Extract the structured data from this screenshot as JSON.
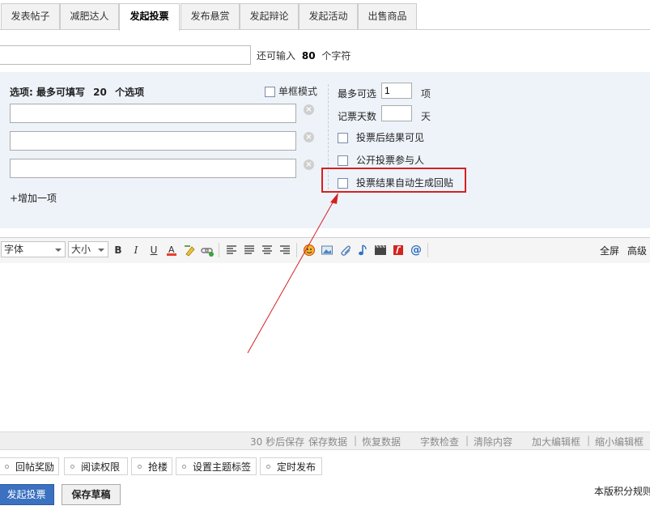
{
  "tabs": [
    {
      "label": "发表帖子",
      "active": false
    },
    {
      "label": "减肥达人",
      "active": false
    },
    {
      "label": "发起投票",
      "active": true
    },
    {
      "label": "发布悬赏",
      "active": false
    },
    {
      "label": "发起辩论",
      "active": false
    },
    {
      "label": "发起活动",
      "active": false
    },
    {
      "label": "出售商品",
      "active": false
    }
  ],
  "subject": {
    "value": "",
    "hint_prefix": "还可输入",
    "remaining": "80",
    "hint_suffix": "个字符"
  },
  "poll": {
    "options_header_prefix": "选项: 最多可填写",
    "max_options": "20",
    "options_header_suffix": "个选项",
    "single_mode_label": "单框模式",
    "options": [
      "",
      "",
      ""
    ],
    "add_option_label": "+增加一项",
    "max_choices_label": "最多可选",
    "max_choices_value": "1",
    "max_choices_unit": "项",
    "days_label": "记票天数",
    "days_value": "",
    "days_unit": "天",
    "check_visible_after_vote": "投票后结果可见",
    "check_public_voters": "公开投票参与人",
    "check_auto_reply": "投票结果自动生成回贴"
  },
  "toolbar": {
    "font_select": "字体",
    "size_select": "大小",
    "bold": "B",
    "italic": "I",
    "underline": "U",
    "fullscreen": "全屏",
    "advanced": "高级"
  },
  "status_bar": {
    "autosave": "30 秒后保存",
    "save_data": "保存数据",
    "restore_data": "恢复数据",
    "word_check": "字数检查",
    "clear_content": "清除内容",
    "enlarge_editor": "加大编辑框",
    "shrink_editor": "缩小编辑框"
  },
  "extras": [
    "回帖奖励",
    "阅读权限",
    "抢楼",
    "设置主题标签",
    "定时发布"
  ],
  "actions": {
    "publish": "发起投票",
    "save_draft": "保存草稿",
    "rules": "本版积分规则"
  },
  "colors": {
    "accent": "#3b71c0",
    "panel_bg": "#eef3fa",
    "annotation": "#d42121"
  }
}
